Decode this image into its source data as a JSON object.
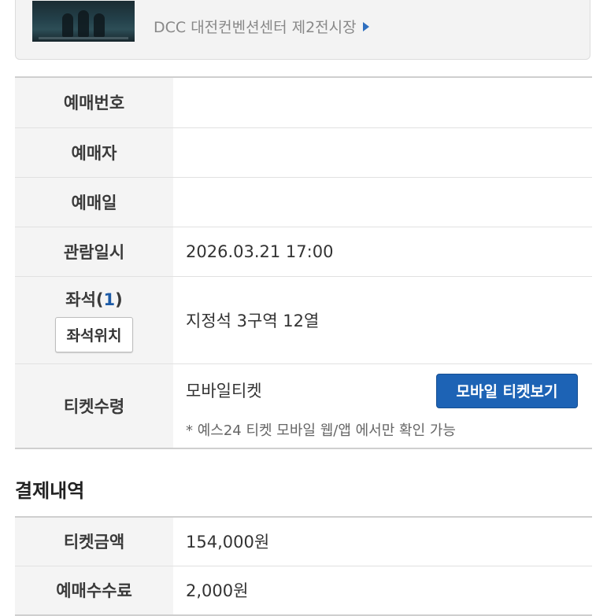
{
  "event": {
    "venue": "DCC 대전컨벤션센터 제2전시장"
  },
  "booking": {
    "rows": [
      {
        "label": "예매번호",
        "value": ""
      },
      {
        "label": "예매자",
        "value": ""
      },
      {
        "label": "예매일",
        "value": ""
      },
      {
        "label": "관람일시",
        "value": "2026.03.21 17:00"
      }
    ],
    "seat": {
      "label": "좌석(",
      "count": "1",
      "label_close": ")",
      "location_button": "좌석위치",
      "value": "지정석 3구역 12열"
    },
    "ticket": {
      "label": "티켓수령",
      "type": "모바일티켓",
      "view_button": "모바일 티켓보기",
      "note": "* 예스24 티켓 모바일 웹/앱 에서만 확인 가능"
    }
  },
  "payment": {
    "title": "결제내역",
    "rows": [
      {
        "label": "티켓금액",
        "value": "154,000원"
      },
      {
        "label": "예매수수료",
        "value": "2,000원"
      }
    ]
  },
  "colors": {
    "accent_blue": "#1d63b5",
    "seat_count_blue": "#1c5aa6",
    "venue_arrow": "#2f6fbf"
  }
}
